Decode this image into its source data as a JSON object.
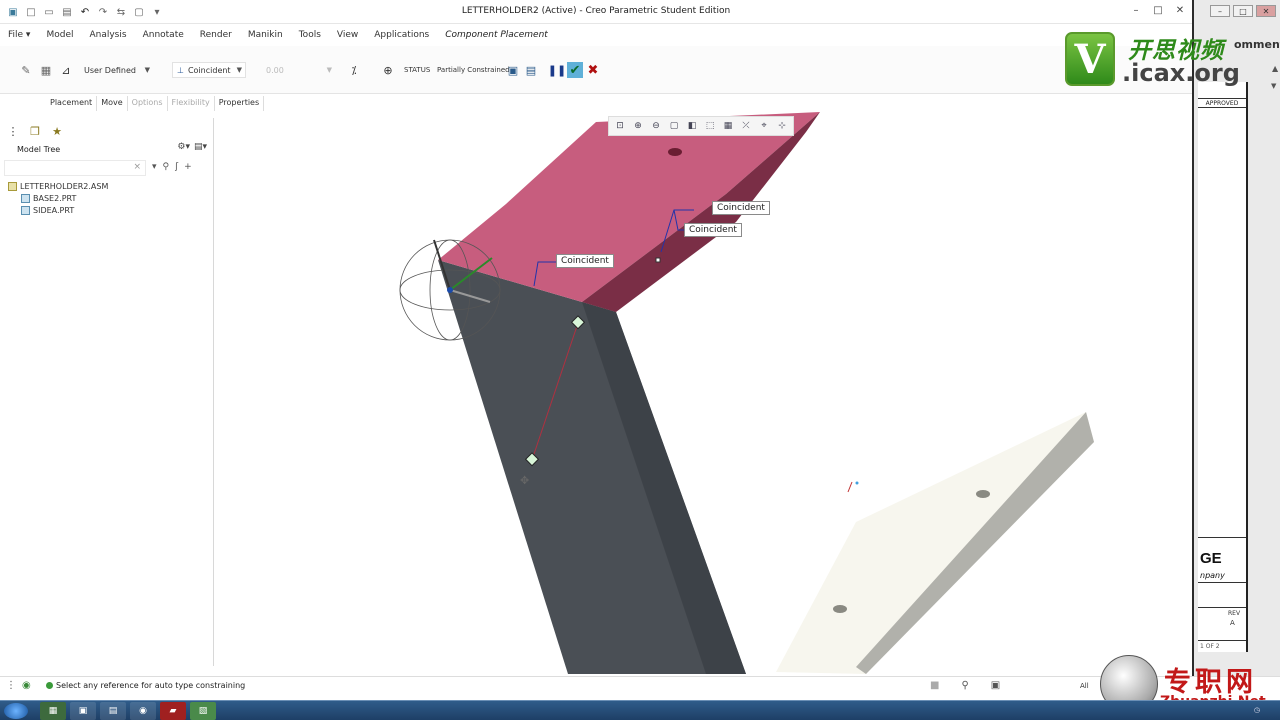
{
  "window": {
    "title": "LETTERHOLDER2 (Active) - Creo Parametric Student Edition"
  },
  "quick_access": [
    "new-icon",
    "open-icon",
    "save-icon",
    "undo-icon",
    "redo-icon",
    "regenerate-icon",
    "windows-icon",
    "customize-icon"
  ],
  "menu": {
    "items": [
      "File ▾",
      "Model",
      "Analysis",
      "Annotate",
      "Render",
      "Manikin",
      "Tools",
      "View",
      "Applications"
    ],
    "active_tab": "Component Placement"
  },
  "ribbon": {
    "constraint_set": "User Defined",
    "constraint_type": "Coincident",
    "offset_value": "0.00",
    "status_label": "STATUS",
    "status_value": "Partially Constrained"
  },
  "subtabs": [
    {
      "label": "Placement",
      "enabled": true
    },
    {
      "label": "Move",
      "enabled": true
    },
    {
      "label": "Options",
      "enabled": false
    },
    {
      "label": "Flexibility",
      "enabled": false
    },
    {
      "label": "Properties",
      "enabled": true
    }
  ],
  "model_tree": {
    "title": "Model Tree",
    "items": [
      {
        "label": "LETTERHOLDER2.ASM",
        "type": "asm"
      },
      {
        "label": "BASE2.PRT",
        "type": "prt"
      },
      {
        "label": "SIDEA.PRT",
        "type": "prt"
      }
    ]
  },
  "viewport": {
    "constraint_labels": [
      "Coincident",
      "Coincident",
      "Coincident"
    ]
  },
  "right_window": {
    "comment_fragment": "omment",
    "approved": "APPROVED",
    "title_fragment": "GE",
    "company_fragment": "npany",
    "rev": "REV",
    "rev_value": "A",
    "sheet": "1 OF 2"
  },
  "watermarks": {
    "logo_letter": "V",
    "logo_cn": "开思视频",
    "logo_url": ".icax.org",
    "zj_cn": "专职网",
    "zj_url": "Zhuanzhi.Net"
  },
  "statusbar": {
    "message": "Select any reference for auto type constraining",
    "filter": "All"
  },
  "colors": {
    "pink_part": "#c75d7e",
    "gray_part": "#4a4f55",
    "base_part": "#f7f6ee",
    "constraint_line": "#2233aa"
  }
}
